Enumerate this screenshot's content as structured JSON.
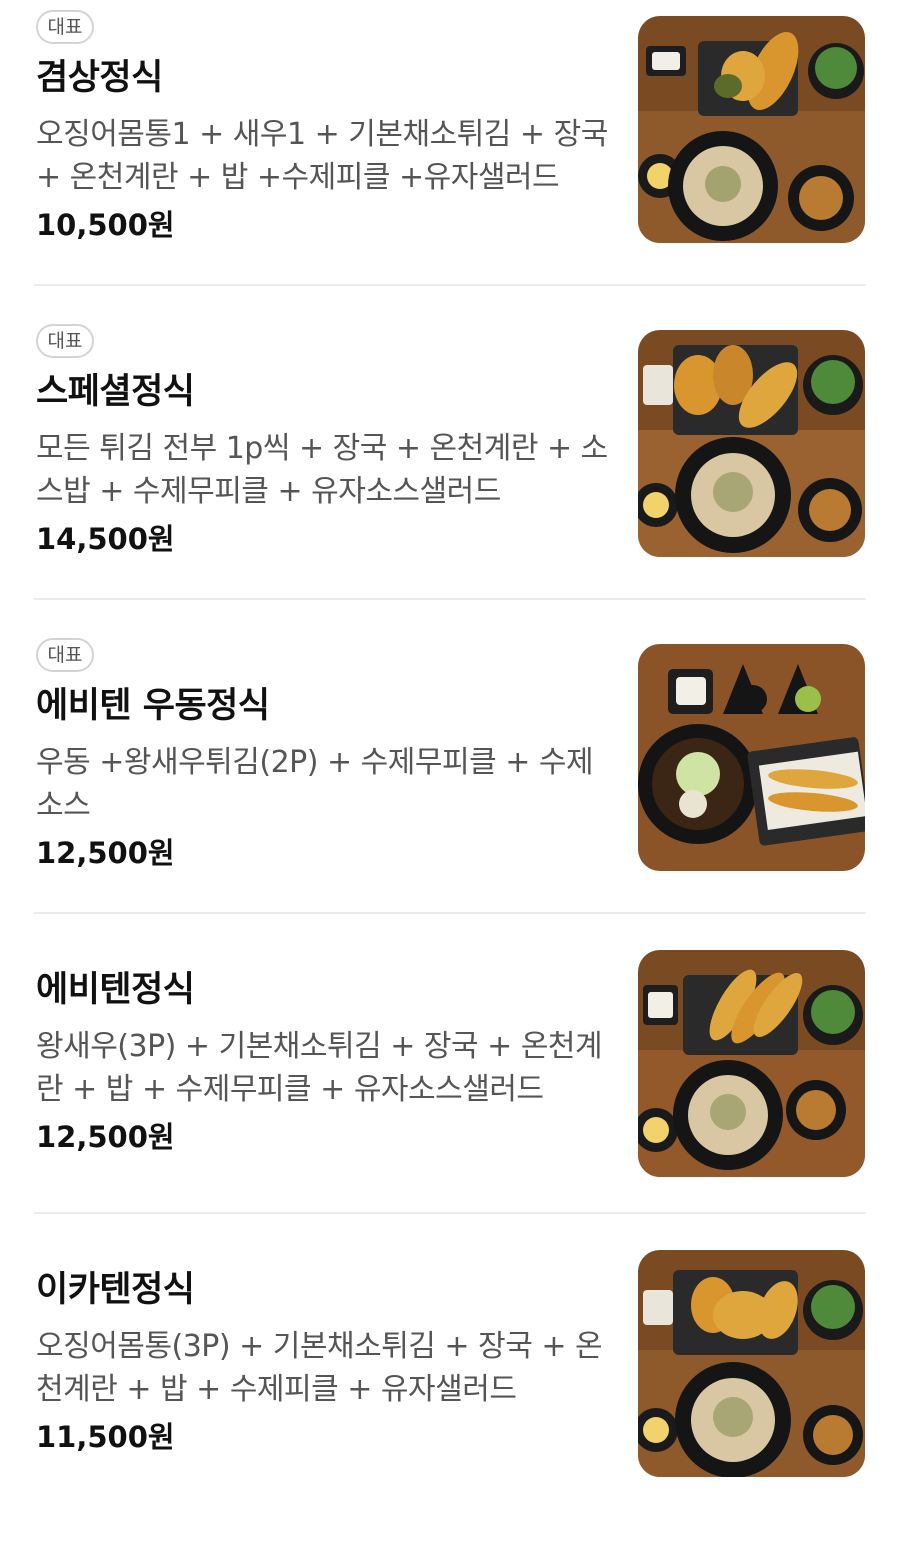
{
  "badge_label": "대표",
  "items": [
    {
      "name": "겸상정식",
      "desc": "오징어몸통1 + 새우1 + 기본채소튀김 + 장국 + 온천계란 + 밥 +수제피클 +유자샐러드",
      "price": "10,500원",
      "badge": true,
      "image": "food-photo"
    },
    {
      "name": "스페셜정식",
      "desc": "모든 튀김 전부 1p씩 + 장국 + 온천계란 + 소스밥 + 수제무피클 + 유자소스샐러드",
      "price": "14,500원",
      "badge": true,
      "image": "food-photo"
    },
    {
      "name": "에비텐 우동정식",
      "desc": "우동 +왕새우튀김(2P) + 수제무피클 + 수제소스",
      "price": "12,500원",
      "badge": true,
      "image": "food-photo"
    },
    {
      "name": "에비텐정식",
      "desc": "왕새우(3P) + 기본채소튀김 + 장국 + 온천계란 + 밥 + 수제무피클 + 유자소스샐러드",
      "price": "12,500원",
      "badge": false,
      "image": "food-photo"
    },
    {
      "name": "이카텐정식",
      "desc": "오징어몸통(3P) + 기본채소튀김 + 장국 + 온천계란 + 밥 + 수제피클 + 유자샐러드",
      "price": "11,500원",
      "badge": false,
      "image": "food-photo"
    }
  ],
  "colors": {
    "text": "#111111",
    "subtext": "#555555",
    "divider": "#ececec",
    "badge_border": "#d4d4d4"
  }
}
